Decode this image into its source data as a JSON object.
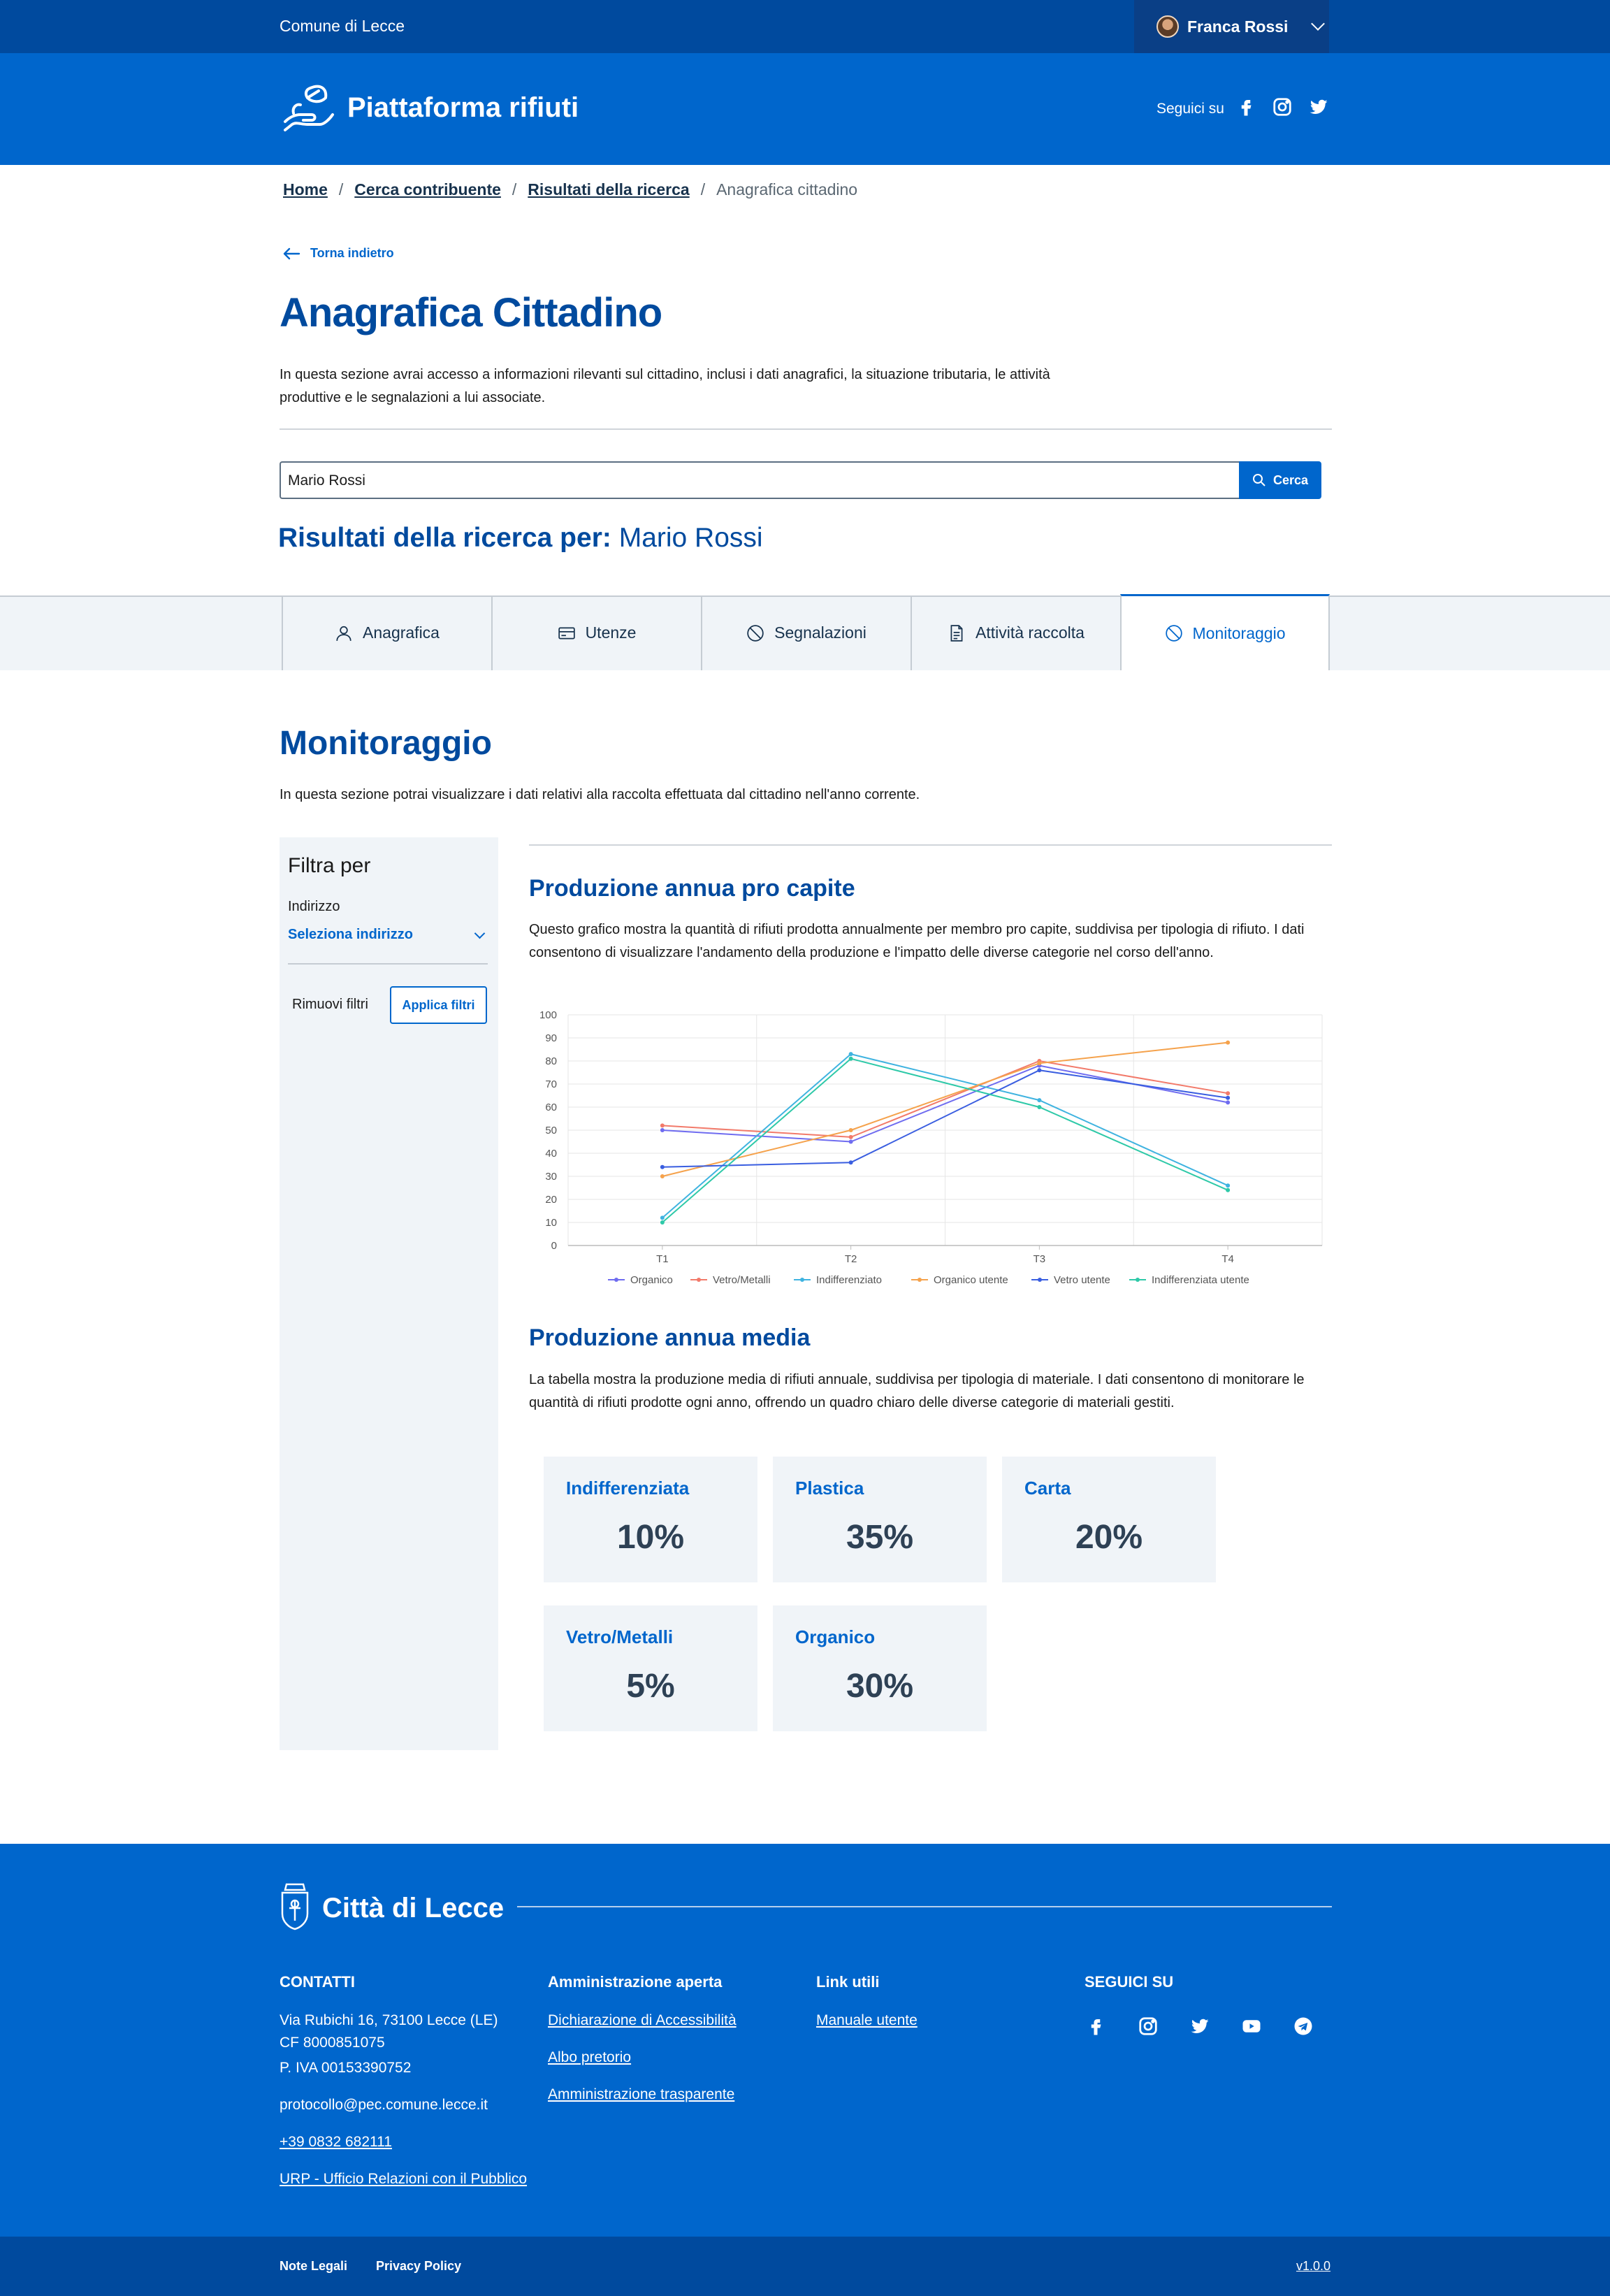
{
  "header": {
    "brand": "Comune di Lecce",
    "user_name": "Franca Rossi",
    "app_title": "Piattaforma rifiuti",
    "follow_label": "Seguici su"
  },
  "breadcrumb": {
    "home": "Home",
    "search": "Cerca contribuente",
    "results": "Risultati della ricerca",
    "current": "Anagrafica cittadino",
    "separator": "/"
  },
  "back_label": "Torna indietro",
  "page": {
    "title": "Anagrafica Cittadino",
    "intro": "In questa sezione avrai accesso a informazioni rilevanti sul cittadino, inclusi i dati anagrafici, la situazione tributaria, le attività produttive e le segnalazioni a lui associate."
  },
  "search": {
    "value": "Mario Rossi",
    "button_label": "Cerca",
    "results_prefix": "Risultati della ricerca per:",
    "results_query": "Mario Rossi"
  },
  "tabs": [
    {
      "label": "Anagrafica",
      "icon": "user-icon"
    },
    {
      "label": "Utenze",
      "icon": "card-icon"
    },
    {
      "label": "Segnalazioni",
      "icon": "ban-icon"
    },
    {
      "label": "Attività raccolta",
      "icon": "document-icon"
    },
    {
      "label": "Monitoraggio",
      "icon": "ban-icon",
      "active": true
    }
  ],
  "section": {
    "title": "Monitoraggio",
    "description": "In questa sezione potrai visualizzare i dati relativi alla raccolta effettuata dal cittadino nell'anno corrente."
  },
  "filter": {
    "title": "Filtra per",
    "address_label": "Indirizzo",
    "address_select": "Seleziona indirizzo",
    "remove_label": "Rimuovi filtri",
    "apply_label": "Applica filtri"
  },
  "chart_section": {
    "title": "Produzione annua pro capite",
    "description": "Questo grafico mostra la quantità di rifiuti prodotta annualmente per membro pro capite, suddivisa per tipologia di rifiuto. I dati consentono di visualizzare l'andamento della produzione e l'impatto delle diverse categorie nel corso dell'anno."
  },
  "chart_data": {
    "type": "line",
    "x": [
      "T1",
      "T2",
      "T3",
      "T4"
    ],
    "ylim": [
      0,
      100
    ],
    "yticks": [
      0,
      10,
      20,
      30,
      40,
      50,
      60,
      70,
      80,
      90,
      100
    ],
    "grid": true,
    "legend_position": "bottom",
    "series": [
      {
        "name": "Organico",
        "color": "#6f6cf0",
        "values": [
          50,
          45,
          78,
          62
        ]
      },
      {
        "name": "Vetro/Metalli",
        "color": "#f27a6a",
        "values": [
          52,
          47,
          80,
          66
        ]
      },
      {
        "name": "Indifferenziato",
        "color": "#3fb3e0",
        "values": [
          12,
          83,
          63,
          26
        ]
      },
      {
        "name": "Organico utente",
        "color": "#f5a24c",
        "values": [
          30,
          50,
          79,
          88
        ]
      },
      {
        "name": "Vetro utente",
        "color": "#3a5ee0",
        "values": [
          34,
          36,
          76,
          64
        ]
      },
      {
        "name": "Indifferenziata utente",
        "color": "#2ec9a8",
        "values": [
          10,
          81,
          60,
          24
        ]
      }
    ]
  },
  "metrics_section": {
    "title": "Produzione annua media",
    "description": "La tabella mostra la produzione media di rifiuti annuale, suddivisa per tipologia di materiale. I dati consentono di monitorare le quantità di rifiuti prodotte ogni anno, offrendo un quadro chiaro delle diverse categorie di materiali gestiti."
  },
  "metrics": [
    {
      "label": "Indifferenziata",
      "value": "10%"
    },
    {
      "label": "Plastica",
      "value": "35%"
    },
    {
      "label": "Carta",
      "value": "20%"
    },
    {
      "label": "Vetro/Metalli",
      "value": "5%"
    },
    {
      "label": "Organico",
      "value": "30%"
    }
  ],
  "footer": {
    "city": "Città di Lecce",
    "contacts_title": "CONTATTI",
    "address": "Via Rubichi 16, 73100 Lecce (LE)",
    "cf": "CF 8000851075",
    "piva": "P. IVA 00153390752",
    "pec": "protocollo@pec.comune.lecce.it",
    "phone": "+39 0832 682111",
    "urp": "URP - Ufficio Relazioni con il Pubblico",
    "admin_title": "Amministrazione aperta",
    "admin_links": [
      "Dichiarazione di Accessibilità",
      "Albo pretorio",
      "Amministrazione trasparente"
    ],
    "links_title": "Link utili",
    "links": [
      "Manuale utente"
    ],
    "social_title": "SEGUICI SU",
    "legal": "Note Legali",
    "privacy": "Privacy Policy",
    "version": "v1.0.0"
  }
}
